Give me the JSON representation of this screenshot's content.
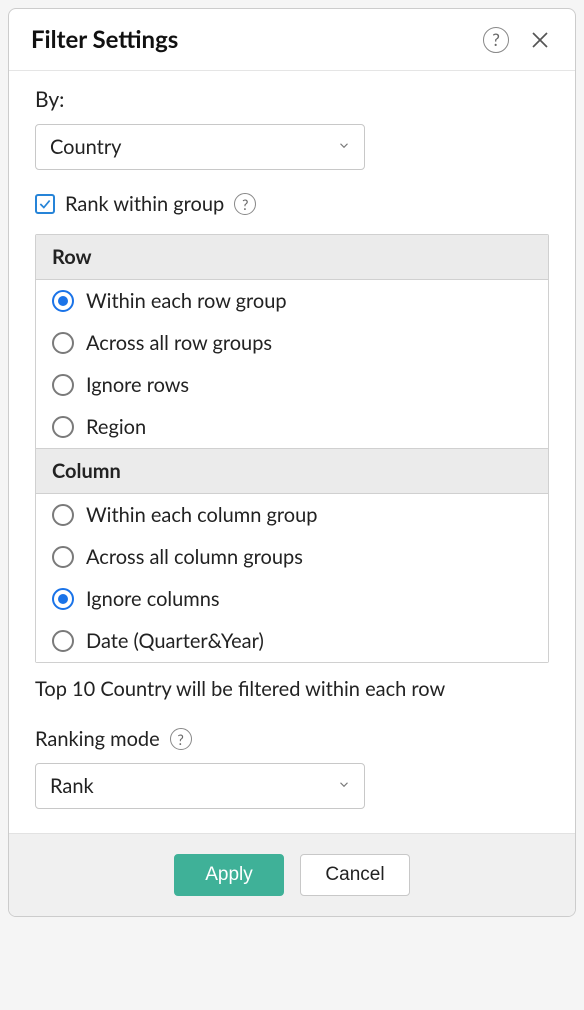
{
  "header": {
    "title": "Filter Settings"
  },
  "by": {
    "label": "By:",
    "selected": "Country"
  },
  "rank_checkbox": {
    "label": "Rank within group",
    "checked": true
  },
  "groups": {
    "row": {
      "header": "Row",
      "options": [
        {
          "label": "Within each row group",
          "checked": true
        },
        {
          "label": "Across all row groups",
          "checked": false
        },
        {
          "label": "Ignore rows",
          "checked": false
        },
        {
          "label": "Region",
          "checked": false
        }
      ]
    },
    "column": {
      "header": "Column",
      "options": [
        {
          "label": "Within each column group",
          "checked": false
        },
        {
          "label": "Across all column groups",
          "checked": false
        },
        {
          "label": "Ignore columns",
          "checked": true
        },
        {
          "label": "Date (Quarter&Year)",
          "checked": false
        }
      ]
    }
  },
  "summary": "Top 10 Country will be filtered within each row",
  "ranking_mode": {
    "label": "Ranking mode",
    "selected": "Rank"
  },
  "footer": {
    "apply": "Apply",
    "cancel": "Cancel"
  }
}
